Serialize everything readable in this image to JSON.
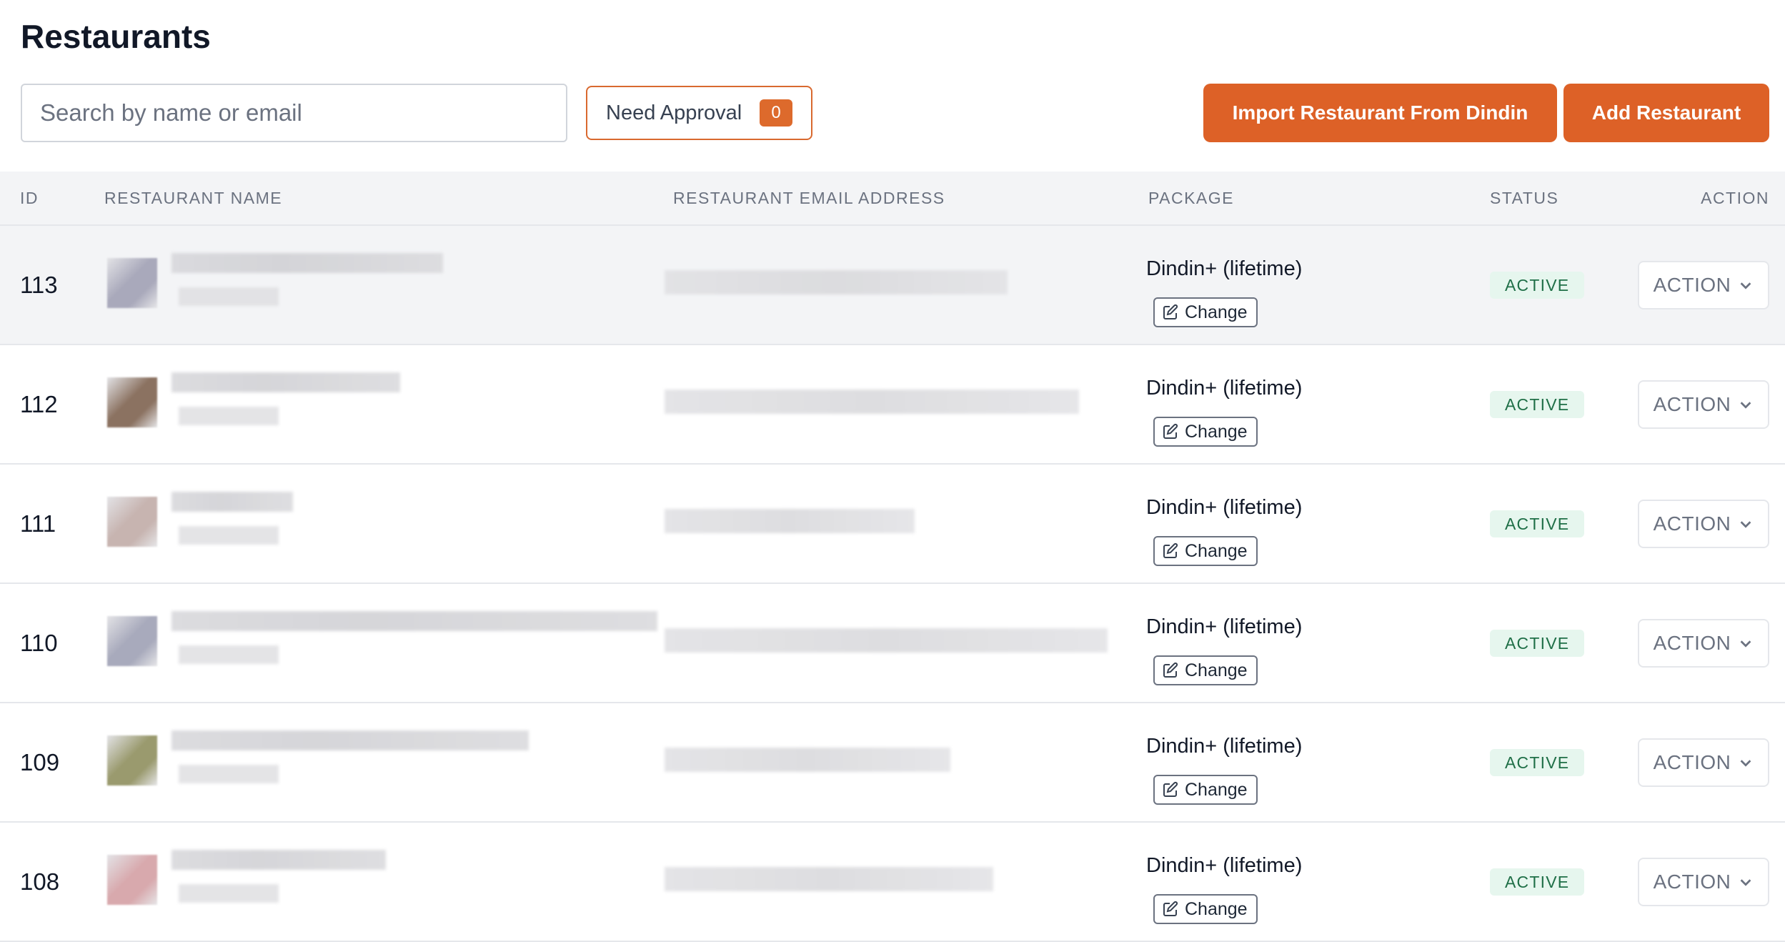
{
  "page": {
    "title": "Restaurants"
  },
  "toolbar": {
    "search_placeholder": "Search by name or email",
    "need_approval_label": "Need Approval",
    "need_approval_count": "0",
    "import_label": "Import Restaurant From Dindin",
    "add_label": "Add Restaurant"
  },
  "table": {
    "headers": {
      "id": "ID",
      "name": "RESTAURANT NAME",
      "email": "RESTAURANT EMAIL ADDRESS",
      "package": "PACKAGE",
      "status": "STATUS",
      "action": "ACTION"
    },
    "rows": [
      {
        "id": "113",
        "package": "Dindin+ (lifetime)",
        "change_label": "Change",
        "status": "ACTIVE",
        "action_label": "ACTION",
        "logo_color": "#a9a9bb"
      },
      {
        "id": "112",
        "package": "Dindin+ (lifetime)",
        "change_label": "Change",
        "status": "ACTIVE",
        "action_label": "ACTION",
        "logo_color": "#8b7261"
      },
      {
        "id": "111",
        "package": "Dindin+ (lifetime)",
        "change_label": "Change",
        "status": "ACTIVE",
        "action_label": "ACTION",
        "logo_color": "#c7b4b0"
      },
      {
        "id": "110",
        "package": "Dindin+ (lifetime)",
        "change_label": "Change",
        "status": "ACTIVE",
        "action_label": "ACTION",
        "logo_color": "#a8aabc"
      },
      {
        "id": "109",
        "package": "Dindin+ (lifetime)",
        "change_label": "Change",
        "status": "ACTIVE",
        "action_label": "ACTION",
        "logo_color": "#9a9a6e"
      },
      {
        "id": "108",
        "package": "Dindin+ (lifetime)",
        "change_label": "Change",
        "status": "ACTIVE",
        "action_label": "ACTION",
        "logo_color": "#d8a9ad"
      }
    ]
  },
  "colors": {
    "accent": "#dd6127",
    "status_bg": "#e6f6ee",
    "status_text": "#1f6f47"
  },
  "icons": {
    "change": "edit-icon",
    "action": "chevron-down-icon"
  }
}
